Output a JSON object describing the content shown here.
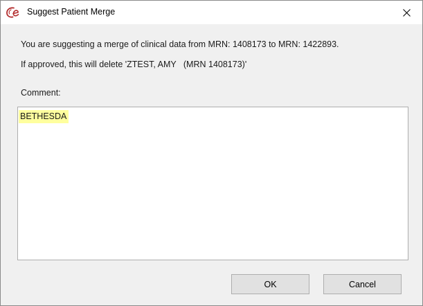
{
  "window": {
    "title": "Suggest Patient Merge",
    "app_logo_icon": "centricity-e-logo-icon",
    "close_icon": "close-icon"
  },
  "message": {
    "line1": "You are suggesting a merge of clinical data from MRN: 1408173 to MRN: 1422893.",
    "line2": "If approved, this will delete 'ZTEST, AMY   (MRN 1408173)'"
  },
  "comment": {
    "label": "Comment:",
    "value": "BETHESDA",
    "highlight_color": "#ffff9e"
  },
  "buttons": {
    "ok_label": "OK",
    "cancel_label": "Cancel"
  },
  "colors": {
    "logo_red": "#c0392b",
    "dialog_bg": "#f0f0f0",
    "button_bg": "#e1e1e1"
  }
}
